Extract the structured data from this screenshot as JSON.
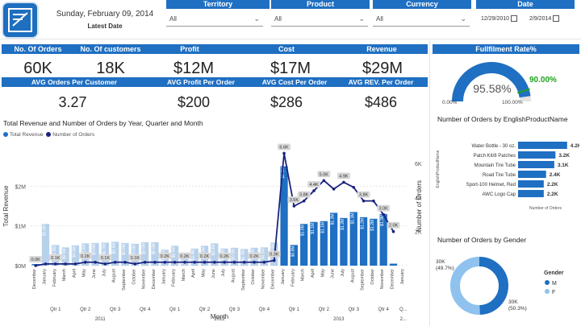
{
  "header": {
    "date": "Sunday, February 09, 2014",
    "latest_label": "Latest Date"
  },
  "filters": [
    {
      "label": "Territory",
      "value": "All"
    },
    {
      "label": "Product",
      "value": "All"
    },
    {
      "label": "Currency",
      "value": "All"
    }
  ],
  "date_filter": {
    "label": "Date",
    "from": "12/29/2010",
    "to": "2/9/2014"
  },
  "kpis": [
    {
      "label": "No. Of Orders",
      "value": "60K"
    },
    {
      "label": "No. Of customers",
      "value": "18K"
    },
    {
      "label": "Profit",
      "value": "$12M"
    },
    {
      "label": "Cost",
      "value": "$17M"
    },
    {
      "label": "Revenue",
      "value": "$29M"
    }
  ],
  "avg_kpis": [
    {
      "label": "AVG Orders Per Customer",
      "value": "3.27"
    },
    {
      "label": "AVG Profit Per Order",
      "value": "$200"
    },
    {
      "label": "AVG Cost Per Order",
      "value": "$286"
    },
    {
      "label": "AVG REV. Per Order",
      "value": "$486"
    }
  ],
  "gauge": {
    "title": "Fullfilment Rate%",
    "value": "95.58%",
    "target": "90.00%",
    "min": "0.00%",
    "max": "100.00%",
    "fraction": 0.9558,
    "target_fraction": 0.9
  },
  "main_chart": {
    "title": "Total Revenue and Number of Orders by Year, Quarter and Month",
    "legend": [
      {
        "name": "Total Revenue",
        "color": "#1f6fc2"
      },
      {
        "name": "Number of Orders",
        "color": "#1a237e"
      }
    ],
    "ylabel": "Total Revenue",
    "y2label": "Number of Orders",
    "xlabel": "Month",
    "y_ticks": [
      "$0M",
      "$1M",
      "$2M"
    ],
    "y2_ticks": [
      "2K",
      "4K",
      "6K"
    ],
    "quarters": [
      "Qtr 1",
      "Qtr 2",
      "Qtr 3",
      "Qtr 4",
      "Qtr 1",
      "Qtr 2",
      "Qtr 3",
      "Qtr 4",
      "Qtr 1",
      "Qtr 2",
      "Qtr 3",
      "Qtr 4",
      "Q..."
    ],
    "years": [
      "2011",
      "2012",
      "2013",
      "2..."
    ]
  },
  "chart_data": {
    "type": "bar",
    "categories": [
      "December",
      "January",
      "February",
      "March",
      "April",
      "May",
      "June",
      "July",
      "August",
      "September",
      "October",
      "November",
      "December",
      "January",
      "February",
      "March",
      "April",
      "May",
      "June",
      "July",
      "August",
      "September",
      "October",
      "November",
      "December",
      "January",
      "February",
      "March",
      "April",
      "May",
      "June",
      "July",
      "August",
      "September",
      "October",
      "November",
      "December",
      "January"
    ],
    "series": [
      {
        "name": "Total Revenue",
        "values": [
          0.04,
          1.05,
          0.52,
          0.46,
          0.51,
          0.56,
          0.57,
          0.58,
          0.6,
          0.57,
          0.55,
          0.59,
          0.59,
          0.4,
          0.5,
          0.33,
          0.43,
          0.5,
          0.56,
          0.43,
          0.45,
          0.42,
          0.45,
          0.46,
          0.58,
          2.5,
          0.52,
          1.05,
          1.1,
          1.12,
          1.33,
          1.2,
          1.35,
          1.22,
          1.18,
          1.3,
          0.05
        ]
      },
      {
        "name": "Number of Orders",
        "values": [
          0.0,
          0.1,
          0.1,
          0.1,
          0.1,
          0.2,
          0.2,
          0.1,
          0.2,
          0.2,
          0.1,
          0.2,
          0.2,
          0.2,
          0.2,
          0.2,
          0.2,
          0.2,
          0.2,
          0.2,
          0.2,
          0.2,
          0.2,
          0.2,
          0.3,
          6.6,
          3.5,
          3.8,
          4.4,
          5.0,
          4.5,
          4.9,
          4.6,
          3.8,
          3.8,
          3.0,
          2.0
        ]
      }
    ],
    "bar_labels": [
      "0.0M",
      "$1.0M",
      "$0.5M",
      "$0.5M",
      "$0.5M",
      "$0.6M",
      "$0.6M",
      "$0.6M",
      "$0.6M",
      "$0.6M",
      "$0.6M",
      "$0.6M",
      "$0.6M",
      "$0.4M",
      "$0.5M",
      "$0.3M",
      "$0.4M",
      "$0.5M",
      "$0.6M",
      "$0.4M",
      "$0.5M",
      "$0.4M",
      "$0.5M",
      "$0.5M",
      "$0.6M",
      "$2.5M",
      "$0.8M",
      "$1.0M",
      "$1.1M",
      "$1.1M",
      "$1.3M",
      "$1.2M",
      "$1.3M",
      "$1.2M",
      "$1.2M",
      "$1.3M",
      ""
    ],
    "order_labels": [
      "0.0K",
      "0.1K",
      "0.1K",
      "0.1K",
      "0.1K",
      "0.2K",
      "0.2K",
      "0.1K",
      "0.2K",
      "0.2K",
      "0.1K",
      "0.2K",
      "0.2K",
      "0.2K",
      "0.2K",
      "0.2K",
      "0.2K",
      "0.2K",
      "0.2K",
      "0.2K",
      "0.2K",
      "0.2K",
      "0.2K",
      "0.2K",
      "0.3K",
      "6.6K",
      "3.5K",
      "3.8K",
      "4.4K",
      "5.0K",
      "4.5K",
      "4.9K",
      "4.6K",
      "3.8K",
      "3.8K",
      "3.0K",
      "2.0K"
    ],
    "ylim": [
      0,
      3
    ],
    "y2lim": [
      0,
      7
    ]
  },
  "product_chart": {
    "title": "Number of Orders by EnglishProductName",
    "axis_label": "EnglishProductName",
    "x_label": "Number of Orders",
    "items": [
      {
        "name": "Water Bottle - 30 oz.",
        "value": 4.2,
        "label": "4.2K"
      },
      {
        "name": "Patch Kit/8 Patches",
        "value": 3.2,
        "label": "3.2K"
      },
      {
        "name": "Mountain Tire Tube",
        "value": 3.1,
        "label": "3.1K"
      },
      {
        "name": "Road Tire Tube",
        "value": 2.4,
        "label": "2.4K"
      },
      {
        "name": "Sport-100 Helmet, Red",
        "value": 2.2,
        "label": "2.2K"
      },
      {
        "name": "AWC Logo Cap",
        "value": 2.2,
        "label": "2.2K"
      }
    ]
  },
  "gender_chart": {
    "title": "Number of Orders by Gender",
    "legend_title": "Gender",
    "slices": [
      {
        "name": "M",
        "value": 49.7,
        "label": "30K",
        "pct": "(49.7%)",
        "color": "#1f6fc2"
      },
      {
        "name": "F",
        "value": 50.3,
        "label": "30K",
        "pct": "(50.3%)",
        "color": "#8fc2ee"
      }
    ]
  }
}
